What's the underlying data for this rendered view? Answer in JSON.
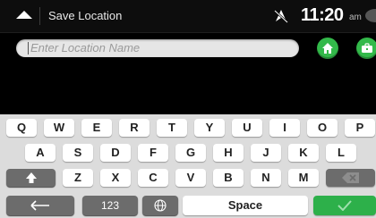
{
  "header": {
    "title": "Save Location",
    "time": "11:20",
    "ampm": "am"
  },
  "search": {
    "placeholder": "Enter Location Name"
  },
  "keyboard": {
    "row1": [
      "Q",
      "W",
      "E",
      "R",
      "T",
      "Y",
      "U",
      "I",
      "O",
      "P"
    ],
    "row2": [
      "A",
      "S",
      "D",
      "F",
      "G",
      "H",
      "J",
      "K",
      "L"
    ],
    "row3": [
      "Z",
      "X",
      "C",
      "V",
      "B",
      "N",
      "M"
    ],
    "numbers_label": "123",
    "space_label": "Space"
  },
  "icons": {
    "back": "back-arrow-icon",
    "gps": "gps-off-icon",
    "sound": "speech-bubble-icon",
    "home": "home-icon",
    "work": "briefcase-icon",
    "shift": "shift-up-icon",
    "delete": "backspace-icon",
    "left": "left-arrow-icon",
    "globe": "globe-icon",
    "done": "checkmark-icon"
  },
  "colors": {
    "accent": "#2db04a",
    "key": "#ffffff",
    "keyboard_bg": "#dcdcdc",
    "dark_key": "#6c6c6c"
  }
}
